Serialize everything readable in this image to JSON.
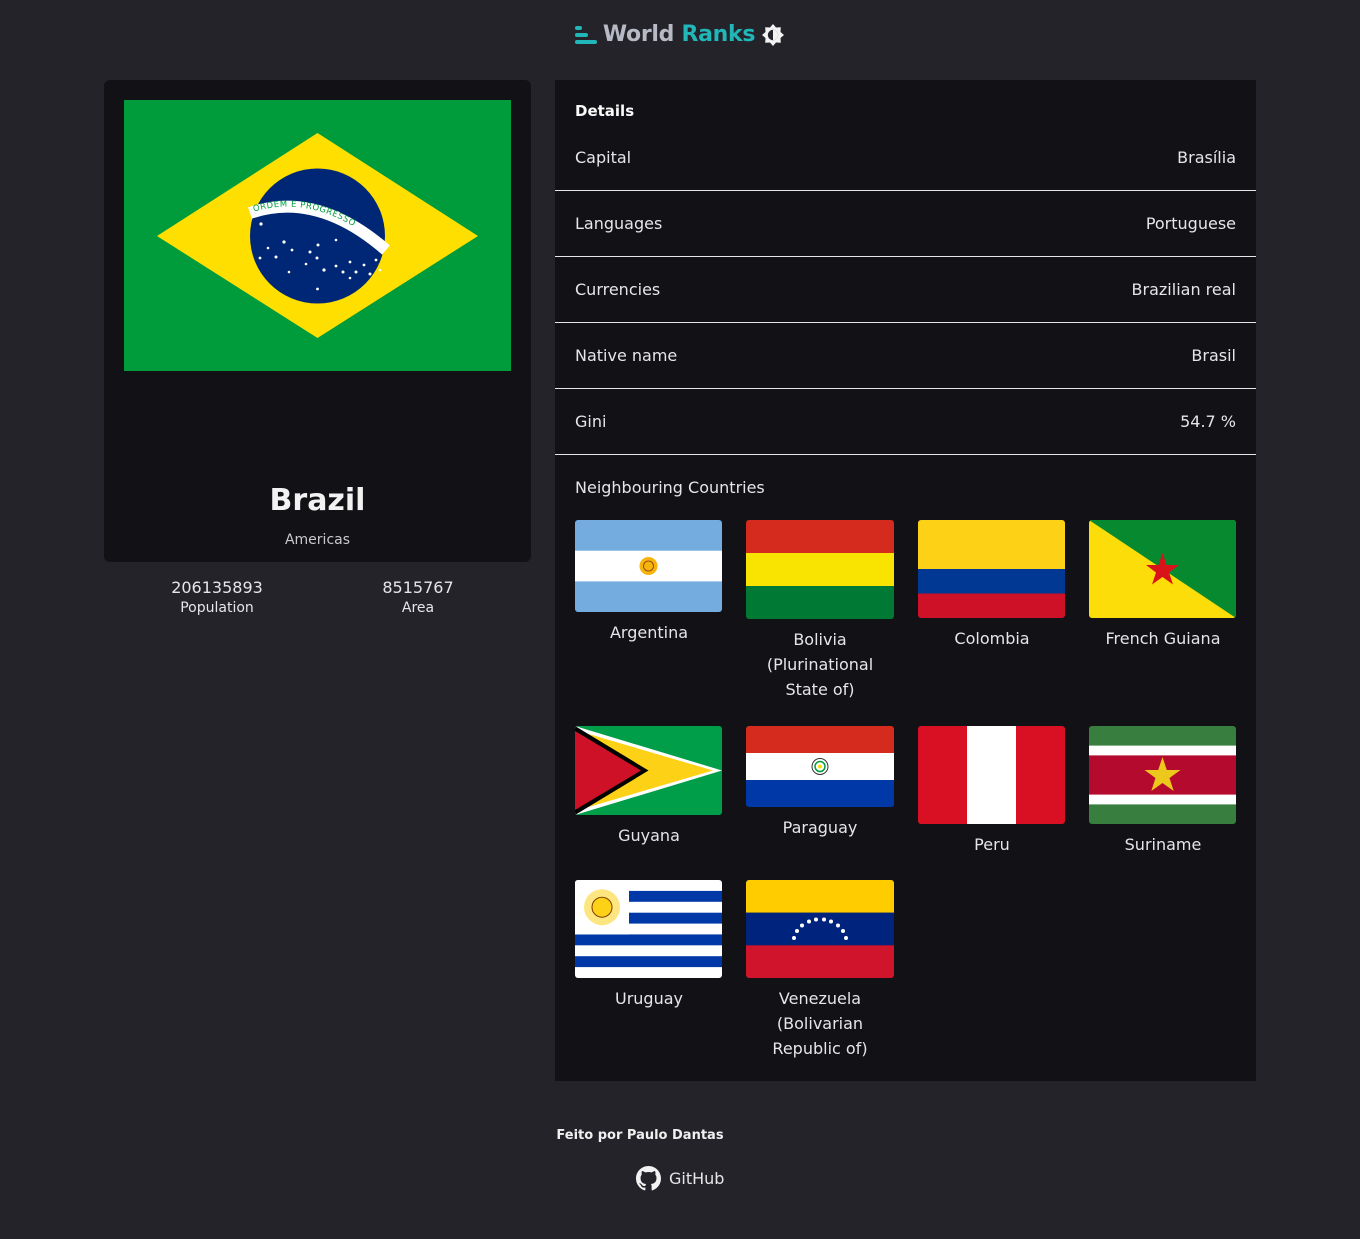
{
  "header": {
    "title_part1": "World",
    "title_part2": "Ranks",
    "logo_icon": "bars-icon",
    "theme_icon": "theme-toggle-icon",
    "accent_color": "#21b6b7"
  },
  "country": {
    "name": "Brazil",
    "region": "Americas",
    "population": "206135893",
    "population_label": "Population",
    "area": "8515767",
    "area_label": "Area",
    "flag_motto": "ORDEM E PROGRESSO"
  },
  "details": {
    "title": "Details",
    "rows": [
      {
        "label": "Capital",
        "value": "Brasília"
      },
      {
        "label": "Languages",
        "value": "Portuguese"
      },
      {
        "label": "Currencies",
        "value": "Brazilian real"
      },
      {
        "label": "Native name",
        "value": "Brasil"
      },
      {
        "label": "Gini",
        "value": "54.7 %"
      }
    ]
  },
  "neighbours": {
    "title": "Neighbouring Countries",
    "items": [
      {
        "name": "Argentina"
      },
      {
        "name": "Bolivia (Plurinational State of)"
      },
      {
        "name": "Colombia"
      },
      {
        "name": "French Guiana"
      },
      {
        "name": "Guyana"
      },
      {
        "name": "Paraguay"
      },
      {
        "name": "Peru"
      },
      {
        "name": "Suriname"
      },
      {
        "name": "Uruguay"
      },
      {
        "name": "Venezuela (Bolivarian Republic of)"
      }
    ]
  },
  "footer": {
    "credit": "Feito por Paulo Dantas",
    "github_label": "GitHub",
    "github_icon": "github-icon"
  }
}
